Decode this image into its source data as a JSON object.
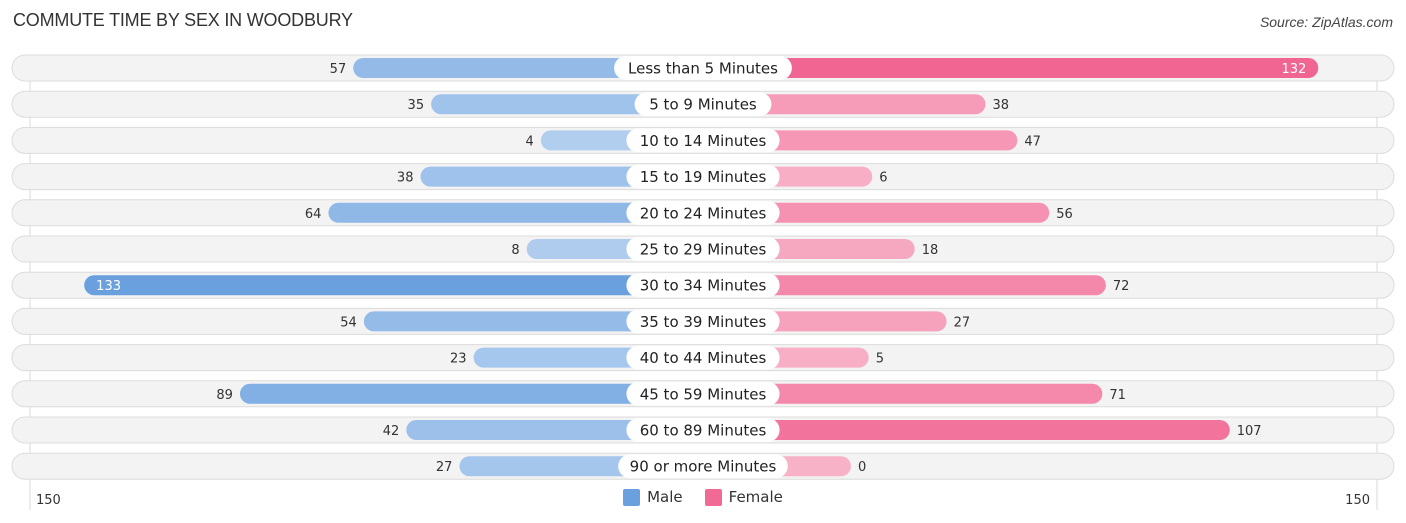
{
  "header": {
    "title": "COMMUTE TIME BY SEX IN WOODBURY",
    "source": "Source: ZipAtlas.com"
  },
  "colors": {
    "male": "#6aa0de",
    "male_light": "#b3cff0",
    "female": "#f06592",
    "female_light": "#f8b2c8",
    "track": "#f2f2f2"
  },
  "legend": [
    {
      "label": "Male",
      "color": "#6aa0de"
    },
    {
      "label": "Female",
      "color": "#f06a95"
    }
  ],
  "chart_data": {
    "type": "bar",
    "orientation": "horizontal-diverging",
    "title": "COMMUTE TIME BY SEX IN WOODBURY",
    "categories": [
      "Less than 5 Minutes",
      "5 to 9 Minutes",
      "10 to 14 Minutes",
      "15 to 19 Minutes",
      "20 to 24 Minutes",
      "25 to 29 Minutes",
      "30 to 34 Minutes",
      "35 to 39 Minutes",
      "40 to 44 Minutes",
      "45 to 59 Minutes",
      "60 to 89 Minutes",
      "90 or more Minutes"
    ],
    "series": [
      {
        "name": "Male",
        "side": "left",
        "values": [
          57,
          35,
          4,
          38,
          64,
          8,
          133,
          54,
          23,
          89,
          42,
          27
        ]
      },
      {
        "name": "Female",
        "side": "right",
        "values": [
          132,
          38,
          47,
          6,
          56,
          18,
          72,
          27,
          5,
          71,
          107,
          0
        ]
      }
    ],
    "axis": {
      "left_label": "150",
      "right_label": "150",
      "max": 150
    },
    "legend_position": "bottom-center",
    "grid": false
  }
}
